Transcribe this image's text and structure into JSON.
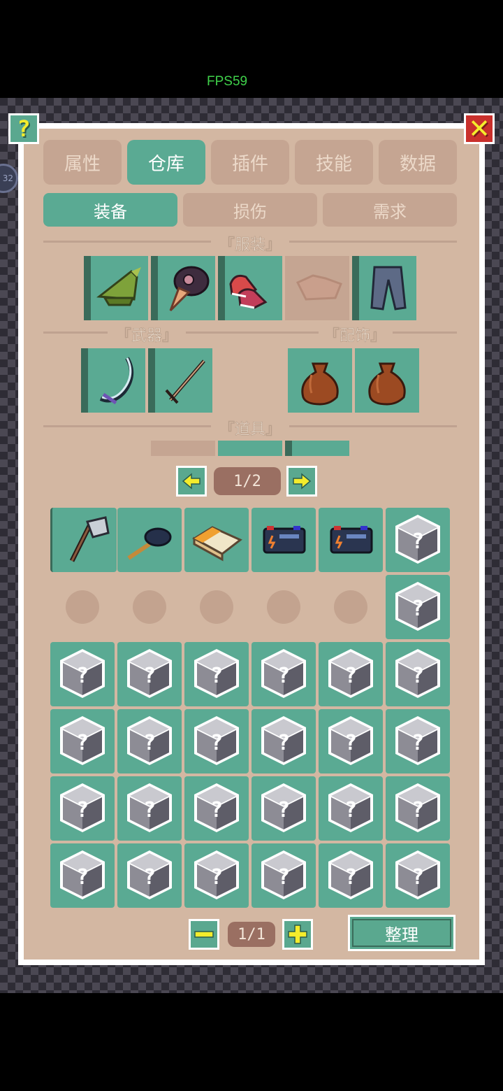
{
  "status": {
    "fps": "FPS59"
  },
  "tabs": [
    {
      "label": "属性"
    },
    {
      "label": "仓库"
    },
    {
      "label": "插件"
    },
    {
      "label": "技能"
    },
    {
      "label": "数据"
    }
  ],
  "subtabs": [
    {
      "label": "装备"
    },
    {
      "label": "损伤"
    },
    {
      "label": "需求"
    }
  ],
  "sections": {
    "clothing": "『服装』",
    "weapons": "『武器』",
    "accessories": "『配饰』",
    "items": "『道具』"
  },
  "equipment": {
    "clothing": [
      "green-hat-icon",
      "plague-mask-icon",
      "sneakers-icon",
      "vest-icon",
      "pants-icon"
    ],
    "weapons": [
      "scythe-icon",
      "spear-icon"
    ],
    "accessories": [
      "pouch-icon",
      "pouch-icon"
    ]
  },
  "top_pager": {
    "label": "1/2"
  },
  "inventory": {
    "row1": [
      "axe-icon",
      "frying-pan-icon",
      "cigarettes-icon",
      "battery-icon",
      "battery-icon",
      "mystery-box-icon"
    ]
  },
  "bottom_pager": {
    "label": "1/1"
  },
  "sort_button": {
    "label": "整理"
  },
  "colors": {
    "accent": "#5aaa93",
    "panel": "#d3b7a2",
    "inactive_tab": "#c5a592",
    "button_yellow": "#f4ec2c"
  }
}
